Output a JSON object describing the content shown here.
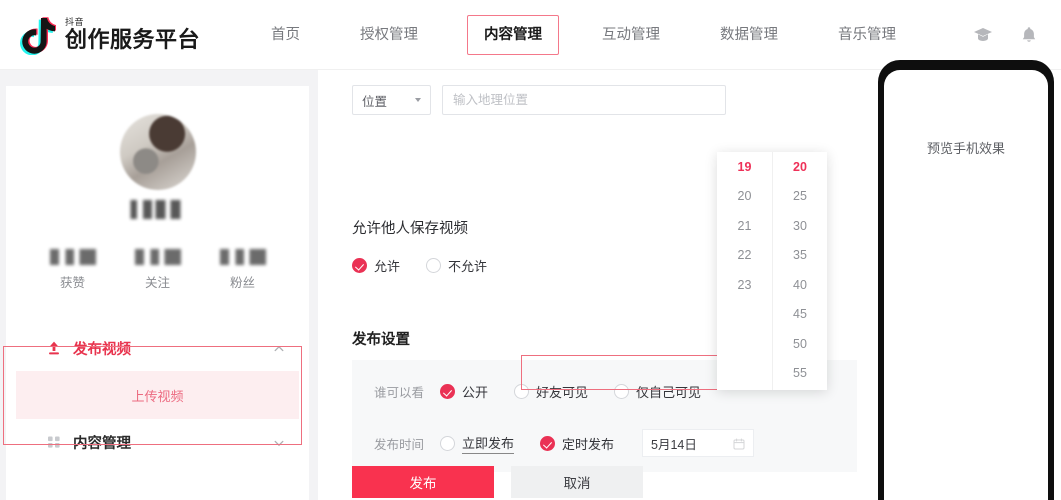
{
  "header": {
    "brand_sub": "抖音",
    "brand_main": "创作服务平台",
    "logo_icon": "douyin-note-icon",
    "nav": [
      {
        "label": "首页",
        "active": false
      },
      {
        "label": "授权管理",
        "active": false
      },
      {
        "label": "内容管理",
        "active": true
      },
      {
        "label": "互动管理",
        "active": false
      },
      {
        "label": "数据管理",
        "active": false
      },
      {
        "label": "音乐管理",
        "active": false
      }
    ],
    "icons": [
      {
        "name": "graduation-cap-icon"
      },
      {
        "name": "bell-icon"
      }
    ]
  },
  "sidebar": {
    "profile": {
      "avatar": "blurred-user-avatar",
      "username": "",
      "stats": [
        {
          "value": "",
          "label": "获赞"
        },
        {
          "value": "",
          "label": "关注"
        },
        {
          "value": "",
          "label": "粉丝"
        }
      ]
    },
    "menu": [
      {
        "label": "发布视频",
        "icon": "upload-icon",
        "chevron": "chevron-up-icon",
        "active": true,
        "children": [
          {
            "label": "上传视频",
            "selected": true
          }
        ]
      },
      {
        "label": "内容管理",
        "icon": "grid-icon",
        "chevron": "chevron-down-icon",
        "active": false,
        "children": []
      }
    ]
  },
  "main": {
    "location": {
      "select_value": "位置",
      "caret_icon": "caret-down-icon",
      "input_value": "",
      "input_placeholder": "输入地理位置"
    },
    "save_section": {
      "title": "允许他人保存视频",
      "options": [
        {
          "label": "允许",
          "selected": true
        },
        {
          "label": "不允许",
          "selected": false
        }
      ]
    },
    "publish_section": {
      "title": "发布设置",
      "visibility": {
        "key": "谁可以看",
        "options": [
          {
            "label": "公开",
            "selected": true
          },
          {
            "label": "好友可见",
            "selected": false
          },
          {
            "label": "仅自己可见",
            "selected": false
          }
        ]
      },
      "publish_time": {
        "key": "发布时间",
        "options": [
          {
            "label": "立即发布",
            "selected": false
          },
          {
            "label": "定时发布",
            "selected": true
          }
        ],
        "date_value": "5月14日",
        "calendar_icon": "calendar-icon"
      }
    },
    "time_picker": {
      "hours": [
        {
          "value": "19",
          "selected": true
        },
        {
          "value": "20",
          "selected": false
        },
        {
          "value": "21",
          "selected": false
        },
        {
          "value": "22",
          "selected": false
        },
        {
          "value": "23",
          "selected": false
        }
      ],
      "minutes": [
        {
          "value": "20",
          "selected": true
        },
        {
          "value": "25",
          "selected": false
        },
        {
          "value": "30",
          "selected": false
        },
        {
          "value": "35",
          "selected": false
        },
        {
          "value": "40",
          "selected": false
        },
        {
          "value": "45",
          "selected": false
        },
        {
          "value": "50",
          "selected": false
        },
        {
          "value": "55",
          "selected": false
        }
      ]
    },
    "footer": {
      "publish_label": "发布",
      "cancel_label": "取消"
    }
  },
  "preview": {
    "label": "预览手机效果"
  },
  "colors": {
    "brand_red": "#FE2C55",
    "primary_button": "#F9324F",
    "accent_selected": "#EA3255",
    "annotation_box": "#EE6F7F",
    "submenu_bg": "#FDEEF0",
    "panel_bg": "#F7F8F9",
    "page_bg": "#F3F3F5"
  }
}
